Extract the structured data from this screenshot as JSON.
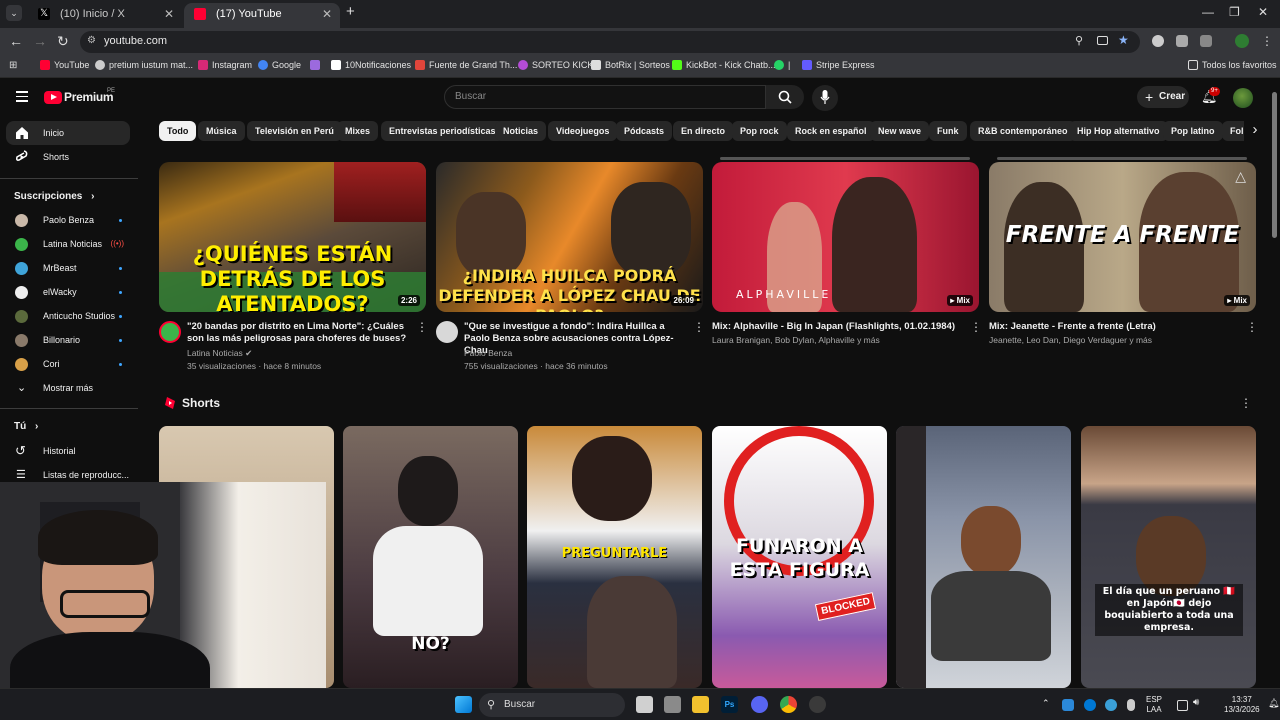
{
  "browser": {
    "tabs": [
      {
        "label": "(10) Inicio / X",
        "active": false
      },
      {
        "label": "(17) YouTube",
        "active": true
      }
    ],
    "new_tab": "+",
    "url": "youtube.com",
    "bookmarks": [
      {
        "label": "YouTube",
        "color": "#ff0033"
      },
      {
        "label": "pretium iustum mat...",
        "color": "#cccccc"
      },
      {
        "label": "Instagram",
        "color": "#d62976"
      },
      {
        "label": "Google",
        "color": "#4285f4"
      },
      {
        "label": "",
        "color": "#9c6ade"
      },
      {
        "label": "10Notificaciones",
        "color": "#ffffff"
      },
      {
        "label": "Fuente de Grand Th...",
        "color": "#e0453b"
      },
      {
        "label": "SORTEO KICK",
        "color": "#b44cd6"
      },
      {
        "label": "BotRix | Sorteos",
        "color": "#dddddd"
      },
      {
        "label": "KickBot - Kick Chatb...",
        "color": "#53fc18"
      },
      {
        "label": "|",
        "color": "#25d366"
      },
      {
        "label": "Stripe Express",
        "color": "#635bff"
      }
    ],
    "all_favorites": "Todos los favoritos"
  },
  "youtube": {
    "logo": "Premium",
    "region": "PE",
    "search_placeholder": "Buscar",
    "create_label": "Crear",
    "notif_count": "9+"
  },
  "sidebar": {
    "main": [
      {
        "label": "Inicio",
        "icon": "home-icon",
        "active": true
      },
      {
        "label": "Shorts",
        "icon": "shorts-icon",
        "active": false
      }
    ],
    "subs_title": "Suscripciones",
    "subs": [
      {
        "label": "Paolo Benza",
        "color": "#c9b8a8",
        "badge": "dot"
      },
      {
        "label": "Latina Noticias",
        "color": "#3bb54a",
        "badge": "live"
      },
      {
        "label": "MrBeast",
        "color": "#3fa4d9",
        "badge": "dot"
      },
      {
        "label": "elWacky",
        "color": "#eeeeee",
        "badge": "dot"
      },
      {
        "label": "Anticucho Studios",
        "color": "#5b6a3c",
        "badge": "dot"
      },
      {
        "label": "Billonario",
        "color": "#8a7a6a",
        "badge": "dot"
      },
      {
        "label": "Cori",
        "color": "#d8a048",
        "badge": "dot"
      }
    ],
    "show_more": "Mostrar más",
    "you_title": "Tú",
    "you_items": [
      {
        "label": "Historial"
      },
      {
        "label": "Listas de reproducc..."
      }
    ]
  },
  "chips": [
    "Todo",
    "Música",
    "Televisión en Perú",
    "Mixes",
    "Entrevistas periodísticas",
    "Noticias",
    "Videojuegos",
    "Pódcasts",
    "En directo",
    "Pop rock",
    "Rock en español",
    "New wave",
    "Funk",
    "R&B contemporáneo",
    "Hip Hop alternativo",
    "Pop latino",
    "Foll"
  ],
  "videos": [
    {
      "title": "\"20 bandas por distrito en Lima Norte\": ¿Cuáles son las más peligrosas para choferes de buses?",
      "channel": "Latina Noticias",
      "verified": "✔",
      "stats": "35 visualizaciones · hace 8 minutos",
      "duration": "2:26",
      "thumb_text": "¿QUIÉNES ESTÁN DETRÁS DE LOS ATENTADOS?"
    },
    {
      "title": "\"Que se investigue a fondo\": Indira Huillca a Paolo Benza sobre acusaciones contra López-Chau",
      "channel": "Paolo Benza",
      "stats": "755 visualizaciones · hace 36 minutos",
      "duration": "26:09",
      "thumb_text": "¿INDIRA HUILCA PODRÁ DEFENDER A LÓPEZ CHAU DE PAOLO?"
    },
    {
      "title": "Mix: Alphaville - Big In Japan (Flashlights, 01.02.1984)",
      "channel": "Laura Branigan, Bob Dylan, Alphaville y más",
      "duration": "Mix",
      "thumb_text": "ALPHAVILLE"
    },
    {
      "title": "Mix: Jeanette - Frente a frente (Letra)",
      "channel": "Jeanette, Leo Dan, Diego Verdaguer y más",
      "duration": "Mix",
      "thumb_text": "FRENTE A FRENTE"
    }
  ],
  "shorts": {
    "title": "Shorts",
    "items": [
      {
        "text": ""
      },
      {
        "text": "NO?"
      },
      {
        "text": "PREGUNTARLE"
      },
      {
        "text": "FUNARON A ESTA FIGURA",
        "badge": "BLOCKED"
      },
      {
        "text": ""
      },
      {
        "text": "El día que un peruano 🇵🇪 en Japón🇯🇵 dejo boquiabierto a toda una empresa."
      }
    ]
  },
  "taskbar": {
    "search": "Buscar",
    "lang": "ESP",
    "lang_sub": "LAA",
    "time": "13:37",
    "date": "13/3/2026"
  }
}
